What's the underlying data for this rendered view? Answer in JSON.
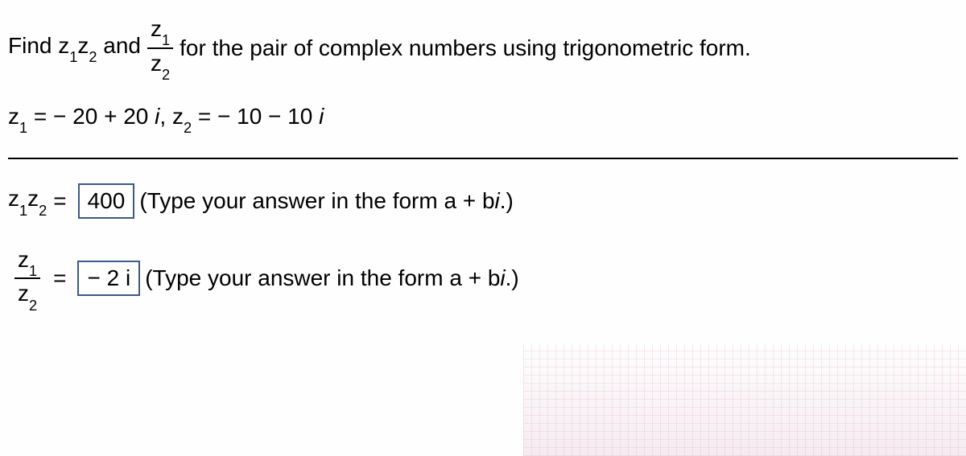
{
  "problem": {
    "prompt_part1": "Find z",
    "prompt_part1_sub": "1",
    "prompt_part2": "z",
    "prompt_part2_sub": "2",
    "prompt_and": " and ",
    "prompt_frac_num": "z",
    "prompt_frac_num_sub": "1",
    "prompt_frac_den": "z",
    "prompt_frac_den_sub": "2",
    "prompt_part3": " for the pair of complex numbers using trigonometric form."
  },
  "given": {
    "lhs1": "z",
    "lhs1_sub": "1",
    "eq1": " = − 20 + 20 ",
    "i1": "i",
    "comma": ", ",
    "lhs2": "z",
    "lhs2_sub": "2",
    "eq2": " = − 10 − 10 ",
    "i2": "i"
  },
  "answer1": {
    "lhs_a": "z",
    "lhs_a_sub": "1",
    "lhs_b": "z",
    "lhs_b_sub": "2",
    "eq": " = ",
    "value": "400",
    "hint": " (Type your answer in the form a + b",
    "i": "i",
    "hint_end": ".)"
  },
  "answer2": {
    "frac_num": "z",
    "frac_num_sub": "1",
    "frac_den": "z",
    "frac_den_sub": "2",
    "eq": " = ",
    "value": "− 2 i",
    "hint": " (Type your answer in the form a + b",
    "i": "i",
    "hint_end": ".)"
  }
}
